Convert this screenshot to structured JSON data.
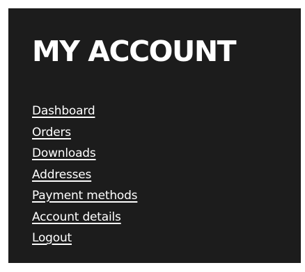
{
  "account": {
    "title": "MY ACCOUNT",
    "nav": [
      {
        "label": "Dashboard"
      },
      {
        "label": "Orders"
      },
      {
        "label": "Downloads"
      },
      {
        "label": "Addresses"
      },
      {
        "label": "Payment methods"
      },
      {
        "label": "Account details"
      },
      {
        "label": "Logout"
      }
    ]
  },
  "colors": {
    "panel_background": "#1c1c1c",
    "text": "#ffffff",
    "page_background": "#ffffff"
  }
}
